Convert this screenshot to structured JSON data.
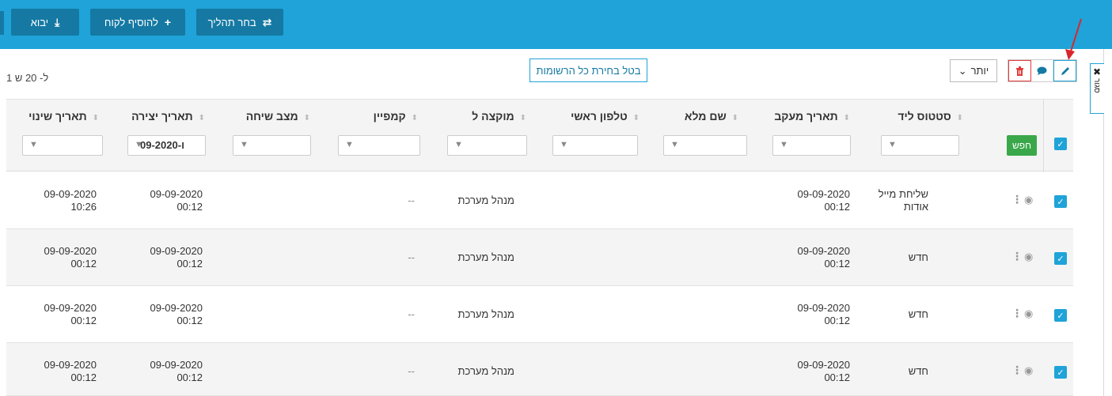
{
  "topbar": {
    "import_label": "יבוא",
    "add_customer_label": "להוסיף לקוח",
    "choose_process_label": "בחר תהליך"
  },
  "sidetab": {
    "close": "✖",
    "label": "סגור"
  },
  "toolbar": {
    "pagination": "1 ל- 20 ש",
    "cancel_selection": "בטל בחירת כל הרשומות",
    "more_label": "יותר",
    "more_caret": "⌄"
  },
  "actions": {
    "delete_icon": "trash-icon",
    "comment_icon": "comment-icon",
    "edit_icon": "pencil-icon"
  },
  "table": {
    "search_label": "חפש",
    "columns": [
      {
        "label": "סטטוס ליד",
        "filter": ""
      },
      {
        "label": "תאריך מעקב",
        "filter": ""
      },
      {
        "label": "שם מלא",
        "filter": ""
      },
      {
        "label": "טלפון ראשי",
        "filter": ""
      },
      {
        "label": "מוקצה ל",
        "filter": ""
      },
      {
        "label": "קמפיין",
        "filter": ""
      },
      {
        "label": "מצב שיחה",
        "filter": ""
      },
      {
        "label": "תאריך יצירה",
        "filter": "09-2020-ו"
      },
      {
        "label": "תאריך שינוי",
        "filter": ""
      }
    ],
    "rows": [
      {
        "status": "שליחת מייל אודות",
        "followup_date": "09-09-2020",
        "followup_time": "00:12",
        "assigned": "מנהל מערכת",
        "campaign": "--",
        "created_date": "09-09-2020",
        "created_time": "00:12",
        "modified_date": "09-09-2020",
        "modified_time": "10:26"
      },
      {
        "status": "חדש",
        "followup_date": "09-09-2020",
        "followup_time": "00:12",
        "assigned": "מנהל מערכת",
        "campaign": "--",
        "created_date": "09-09-2020",
        "created_time": "00:12",
        "modified_date": "09-09-2020",
        "modified_time": "00:12"
      },
      {
        "status": "חדש",
        "followup_date": "09-09-2020",
        "followup_time": "00:12",
        "assigned": "מנהל מערכת",
        "campaign": "--",
        "created_date": "09-09-2020",
        "created_time": "00:12",
        "modified_date": "09-09-2020",
        "modified_time": "00:12"
      },
      {
        "status": "חדש",
        "followup_date": "09-09-2020",
        "followup_time": "00:12",
        "assigned": "מנהל מערכת",
        "campaign": "--",
        "created_date": "09-09-2020",
        "created_time": "00:12",
        "modified_date": "09-09-2020",
        "modified_time": "00:12"
      }
    ]
  },
  "colors": {
    "primary": "#1fa3d8",
    "primary_dark": "#1579a3",
    "success": "#3aa84a",
    "danger": "#e23b3b"
  }
}
